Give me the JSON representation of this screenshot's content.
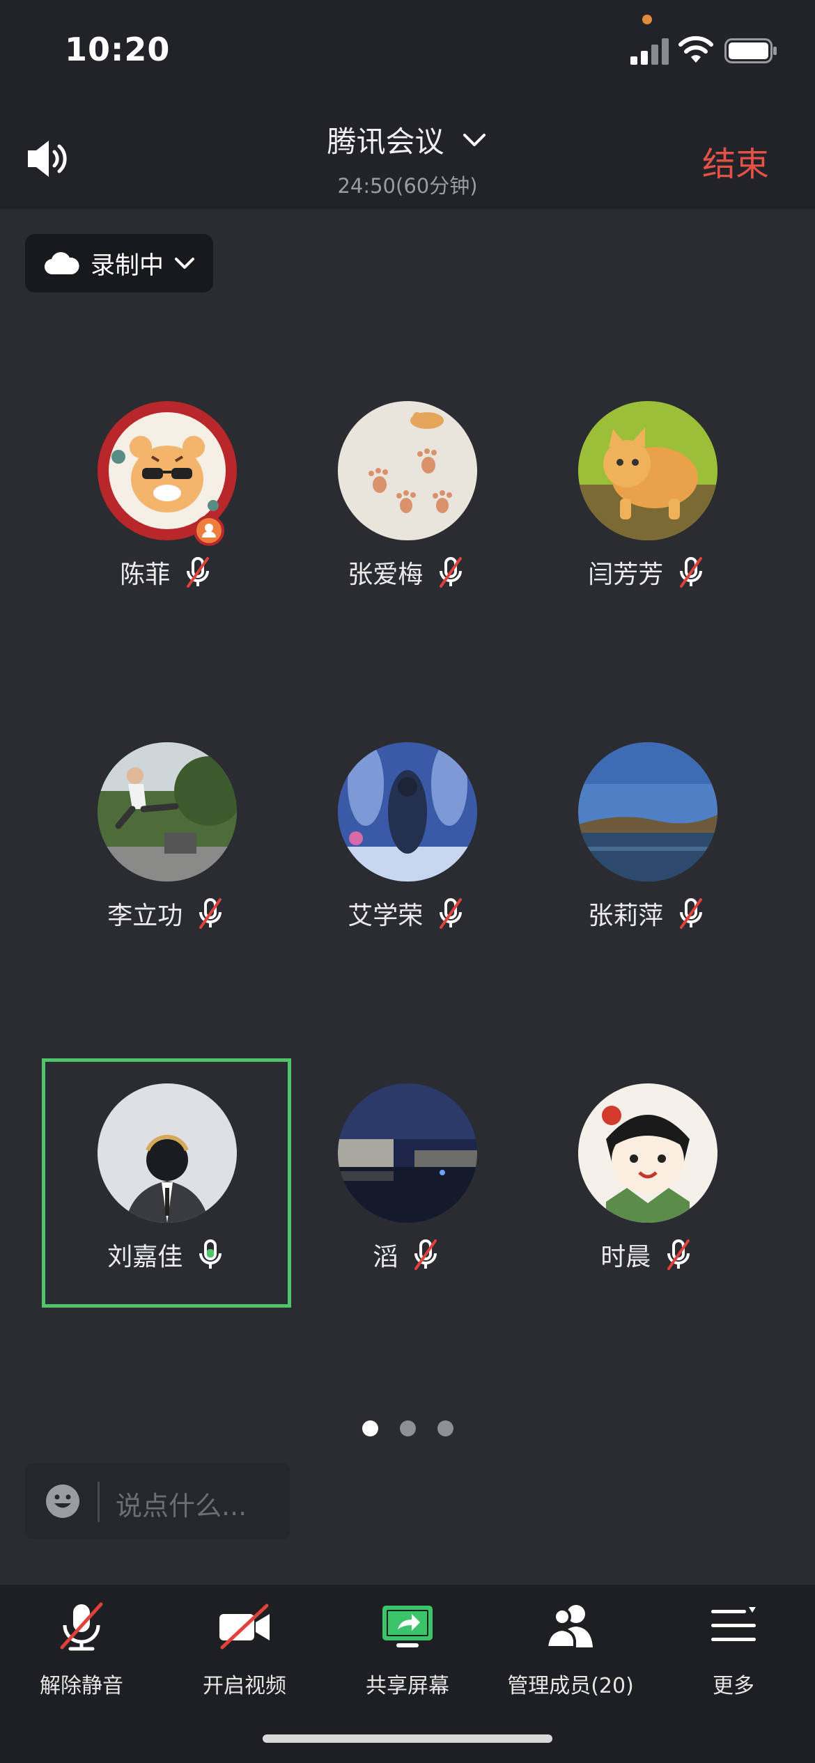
{
  "status_bar": {
    "time": "10:20"
  },
  "header": {
    "title": "腾讯会议",
    "timer": "24:50(60分钟)",
    "end_label": "结束"
  },
  "recording": {
    "label": "录制中"
  },
  "participants": [
    {
      "name": "陈菲",
      "mic": "muted",
      "host": true
    },
    {
      "name": "张爱梅",
      "mic": "muted"
    },
    {
      "name": "闫芳芳",
      "mic": "muted"
    },
    {
      "name": "李立功",
      "mic": "muted"
    },
    {
      "name": "艾学荣",
      "mic": "muted"
    },
    {
      "name": "张莉萍",
      "mic": "muted"
    },
    {
      "name": "刘嘉佳",
      "mic": "active",
      "speaking": true
    },
    {
      "name": "滔",
      "mic": "muted"
    },
    {
      "name": "时晨",
      "mic": "muted"
    }
  ],
  "pagination": {
    "current_page": 1,
    "total_pages": 3
  },
  "chat": {
    "placeholder": "说点什么..."
  },
  "toolbar": {
    "unmute_label": "解除静音",
    "video_label": "开启视频",
    "share_label": "共享屏幕",
    "members_label": "管理成员(20)",
    "more_label": "更多"
  },
  "colors": {
    "end_red": "#e25247",
    "active_green": "#4fc46a",
    "mute_red": "#e0413a",
    "share_green": "#3cc46a"
  }
}
